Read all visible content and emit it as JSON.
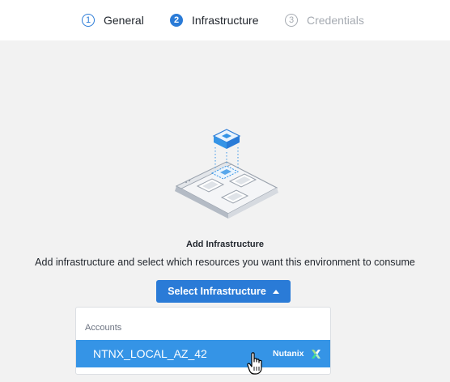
{
  "stepper": {
    "steps": [
      {
        "number": "1",
        "label": "General",
        "state": "complete"
      },
      {
        "number": "2",
        "label": "Infrastructure",
        "state": "active"
      },
      {
        "number": "3",
        "label": "Credentials",
        "state": "pending"
      }
    ]
  },
  "main": {
    "title": "Add Infrastructure",
    "subtitle": "Add infrastructure and select which resources you want this environment to consume",
    "select_button_label": "Select Infrastructure"
  },
  "dropdown": {
    "header": "Accounts",
    "items": [
      {
        "label": "NTNX_LOCAL_AZ_42",
        "provider": "Nutanix",
        "highlighted": true
      }
    ]
  },
  "colors": {
    "accent": "#2a7bd7",
    "highlight": "#3594e6",
    "background": "#f2f2f2"
  }
}
